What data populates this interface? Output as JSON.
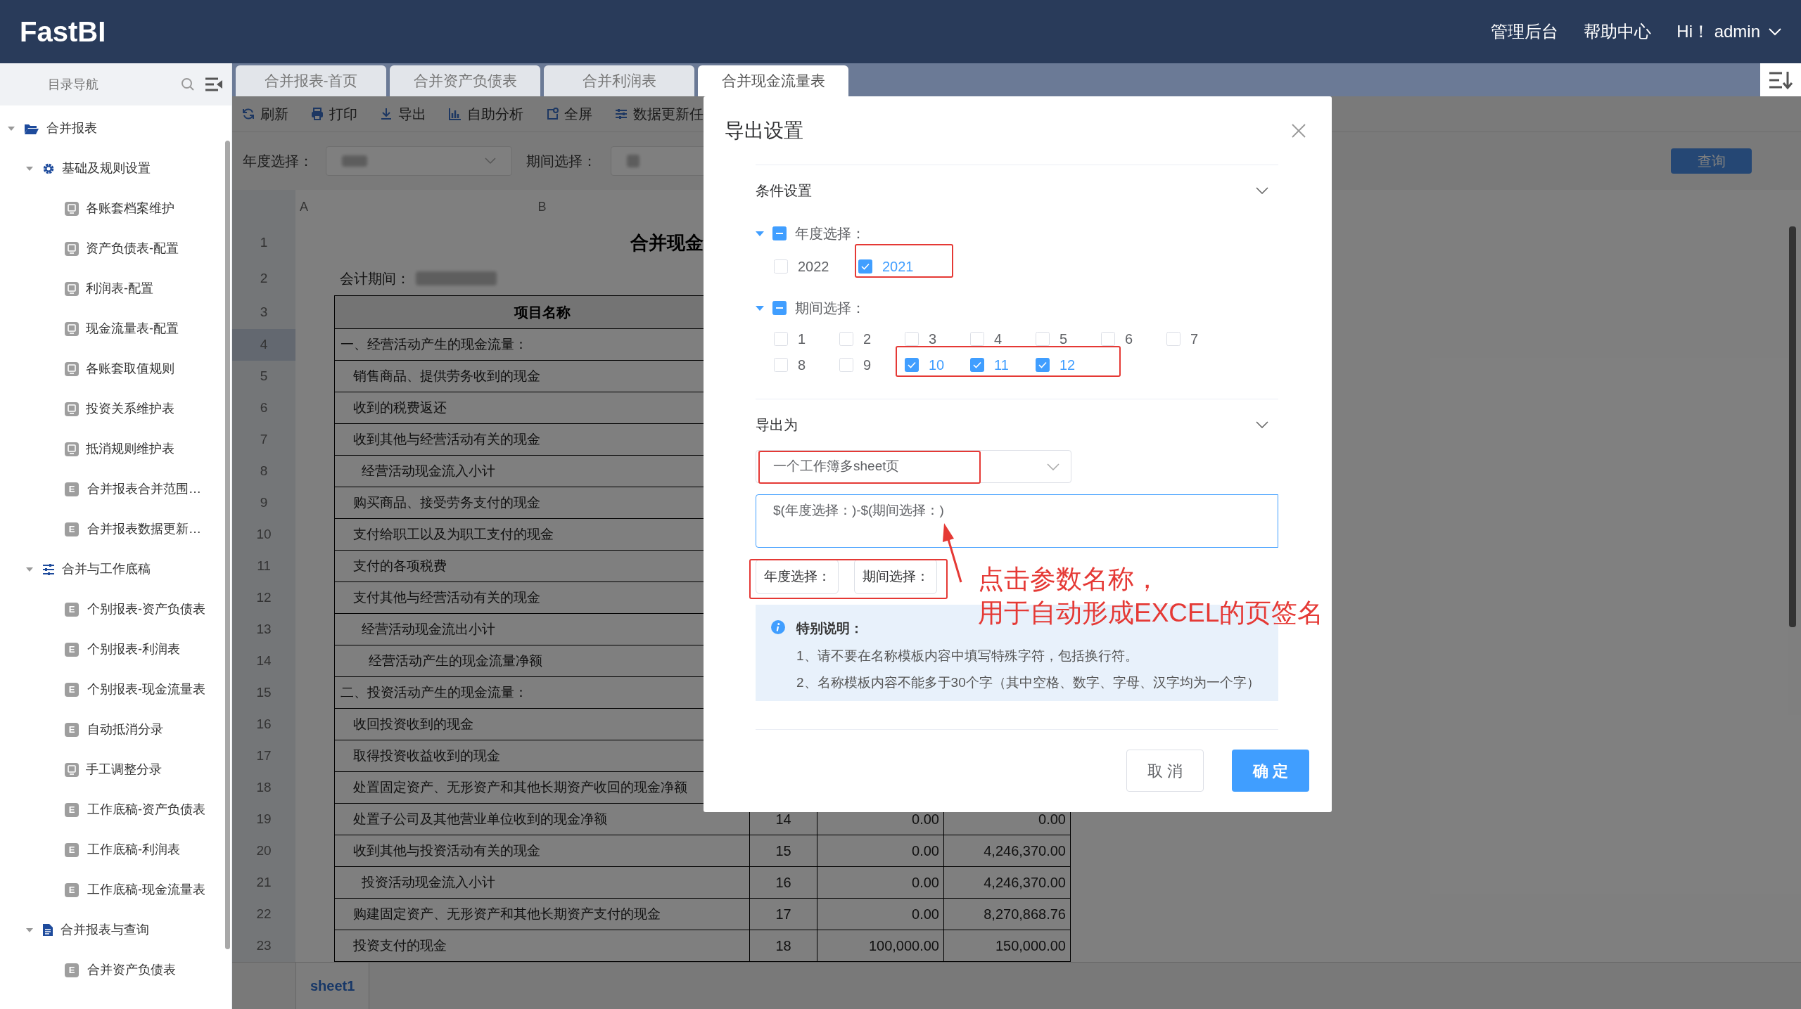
{
  "app": {
    "logo": "FastBI",
    "nav": [
      "管理后台",
      "帮助中心"
    ],
    "user": "Hi！ admin"
  },
  "sidebar": {
    "title": "目录导航",
    "tree": [
      {
        "label": "合并报表",
        "kind": "folder",
        "expanded": true,
        "children": [
          {
            "label": "基础及规则设置",
            "kind": "gear",
            "expanded": true,
            "children": [
              {
                "label": "各账套档案维护",
                "kind": "page"
              },
              {
                "label": "资产负债表-配置",
                "kind": "page"
              },
              {
                "label": "利润表-配置",
                "kind": "page"
              },
              {
                "label": "现金流量表-配置",
                "kind": "page"
              },
              {
                "label": "各账套取值规则",
                "kind": "page"
              },
              {
                "label": "投资关系维护表",
                "kind": "page"
              },
              {
                "label": "抵消规则维护表",
                "kind": "page"
              },
              {
                "label": "合并报表合并范围…",
                "kind": "report",
                "icon_text": "E"
              },
              {
                "label": "合并报表数据更新…",
                "kind": "report",
                "icon_text": "E"
              }
            ]
          },
          {
            "label": "合并与工作底稿",
            "kind": "sliders",
            "expanded": true,
            "children": [
              {
                "label": "个别报表-资产负债表",
                "kind": "report",
                "icon_text": "E"
              },
              {
                "label": "个别报表-利润表",
                "kind": "report",
                "icon_text": "E"
              },
              {
                "label": "个别报表-现金流量表",
                "kind": "report",
                "icon_text": "E"
              },
              {
                "label": "自动抵消分录",
                "kind": "report",
                "icon_text": "E"
              },
              {
                "label": "手工调整分录",
                "kind": "page"
              },
              {
                "label": "工作底稿-资产负债表",
                "kind": "report",
                "icon_text": "E"
              },
              {
                "label": "工作底稿-利润表",
                "kind": "report",
                "icon_text": "E"
              },
              {
                "label": "工作底稿-现金流量表",
                "kind": "report",
                "icon_text": "E"
              }
            ]
          },
          {
            "label": "合并报表与查询",
            "kind": "document",
            "expanded": true,
            "children": [
              {
                "label": "合并资产负债表",
                "kind": "report",
                "icon_text": "E"
              }
            ]
          }
        ]
      }
    ]
  },
  "tabs": [
    {
      "label": "合并报表-首页",
      "selected": false
    },
    {
      "label": "合并资产负债表",
      "selected": false
    },
    {
      "label": "合并利润表",
      "selected": false
    },
    {
      "label": "合并现金流量表",
      "selected": true
    }
  ],
  "toolbar": [
    {
      "label": "刷新",
      "kind": "refresh"
    },
    {
      "label": "打印",
      "kind": "print"
    },
    {
      "label": "导出",
      "kind": "download"
    },
    {
      "label": "自助分析",
      "kind": "chart"
    },
    {
      "label": "全屏",
      "kind": "fullscreen"
    },
    {
      "label": "数据更新任",
      "kind": "sliders"
    }
  ],
  "filters": [
    {
      "label": "年度选择："
    },
    {
      "label": "期间选择："
    }
  ],
  "query_button": "查询",
  "sheet": {
    "columns": [
      "A",
      "B"
    ],
    "title": "合并现金",
    "period_label": "会计期间：",
    "header": "项目名称",
    "row_numbers": [
      {
        "label": "1",
        "selected": false
      },
      {
        "label": "2",
        "selected": false
      },
      {
        "label": "3",
        "selected": false
      },
      {
        "label": "4",
        "selected": true
      },
      {
        "label": "5",
        "selected": false
      },
      {
        "label": "6",
        "selected": false
      },
      {
        "label": "7",
        "selected": false
      },
      {
        "label": "8",
        "selected": false
      },
      {
        "label": "9",
        "selected": false
      },
      {
        "label": "10",
        "selected": false
      },
      {
        "label": "11",
        "selected": false
      },
      {
        "label": "12",
        "selected": false
      },
      {
        "label": "13",
        "selected": false
      },
      {
        "label": "14",
        "selected": false
      },
      {
        "label": "15",
        "selected": false
      },
      {
        "label": "16",
        "selected": false
      },
      {
        "label": "17",
        "selected": false
      },
      {
        "label": "18",
        "selected": false
      },
      {
        "label": "19",
        "selected": false
      },
      {
        "label": "20",
        "selected": false
      },
      {
        "label": "21",
        "selected": false
      },
      {
        "label": "22",
        "selected": false
      },
      {
        "label": "23",
        "selected": false
      }
    ],
    "rows": [
      {
        "item": "一、经营活动产生的现金流量：",
        "kind": "section"
      },
      {
        "item": "销售商品、提供劳务收到的现金",
        "kind": "item"
      },
      {
        "item": "收到的税费返还",
        "kind": "item"
      },
      {
        "item": "收到其他与经营活动有关的现金",
        "kind": "item"
      },
      {
        "item": "经营活动现金流入小计",
        "kind": "subtotal"
      },
      {
        "item": "购买商品、接受劳务支付的现金",
        "kind": "item"
      },
      {
        "item": "支付给职工以及为职工支付的现金",
        "kind": "item"
      },
      {
        "item": "支付的各项税费",
        "kind": "item"
      },
      {
        "item": "支付其他与经营活动有关的现金",
        "kind": "item"
      },
      {
        "item": "经营活动现金流出小计",
        "kind": "subtotal"
      },
      {
        "item": "经营活动产生的现金流量净额",
        "kind": "total"
      },
      {
        "item": "二、投资活动产生的现金流量：",
        "kind": "section"
      },
      {
        "item": "收回投资收到的现金",
        "kind": "item"
      },
      {
        "item": "取得投资收益收到的现金",
        "kind": "item"
      },
      {
        "item": "处置固定资产、无形资产和其他长期资产收回的现金净额",
        "kind": "item"
      },
      {
        "item": "处置子公司及其他营业单位收到的现金净额",
        "kind": "item",
        "line": "14",
        "current": "0.00",
        "previous": "0.00"
      },
      {
        "item": "收到其他与投资活动有关的现金",
        "kind": "item",
        "line": "15",
        "current": "0.00",
        "previous": "4,246,370.00"
      },
      {
        "item": "投资活动现金流入小计",
        "kind": "subtotal",
        "line": "16",
        "current": "0.00",
        "previous": "4,246,370.00"
      },
      {
        "item": "购建固定资产、无形资产和其他长期资产支付的现金",
        "kind": "item",
        "line": "17",
        "current": "0.00",
        "previous": "8,270,868.76"
      },
      {
        "item": "投资支付的现金",
        "kind": "item",
        "line": "18",
        "current": "100,000.00",
        "previous": "150,000.00"
      }
    ],
    "sheet_tabs": [
      {
        "label": "sheet1",
        "selected": true
      }
    ]
  },
  "dialog": {
    "title": "导出设置",
    "condition_section": {
      "title": "条件设置",
      "expanded": true
    },
    "groups": [
      {
        "label": "年度选择：",
        "expanded": true,
        "indeterminate": true,
        "options": [
          {
            "label": "2022",
            "checked": false
          },
          {
            "label": "2021",
            "checked": true
          }
        ]
      },
      {
        "label": "期间选择：",
        "expanded": true,
        "indeterminate": true,
        "options": [
          {
            "label": "1",
            "checked": false
          },
          {
            "label": "2",
            "checked": false
          },
          {
            "label": "3",
            "checked": false
          },
          {
            "label": "4",
            "checked": false
          },
          {
            "label": "5",
            "checked": false
          },
          {
            "label": "6",
            "checked": false
          },
          {
            "label": "7",
            "checked": false
          },
          {
            "label": "8",
            "checked": false
          },
          {
            "label": "9",
            "checked": false
          },
          {
            "label": "10",
            "checked": true
          },
          {
            "label": "11",
            "checked": true
          },
          {
            "label": "12",
            "checked": true
          }
        ]
      }
    ],
    "export_section": {
      "title": "导出为",
      "expanded": true
    },
    "export_mode": "一个工作簿多sheet页",
    "template": "$(年度选择：)-$(期间选择：)",
    "params": [
      "年度选择：",
      "期间选择："
    ],
    "notice": {
      "title": "特别说明：",
      "lines": [
        "1、请不要在名称模板内容中填写特殊字符，包括换行符。",
        "2、名称模板内容不能多于30个字（其中空格、数字、字母、汉字均为一个字）"
      ]
    },
    "buttons": [
      {
        "label": "取 消",
        "kind": "secondary"
      },
      {
        "label": "确 定",
        "kind": "primary"
      }
    ]
  },
  "annotation": {
    "lines": [
      "点击参数名称，",
      "用于自动形成EXCEL的页签名"
    ]
  }
}
